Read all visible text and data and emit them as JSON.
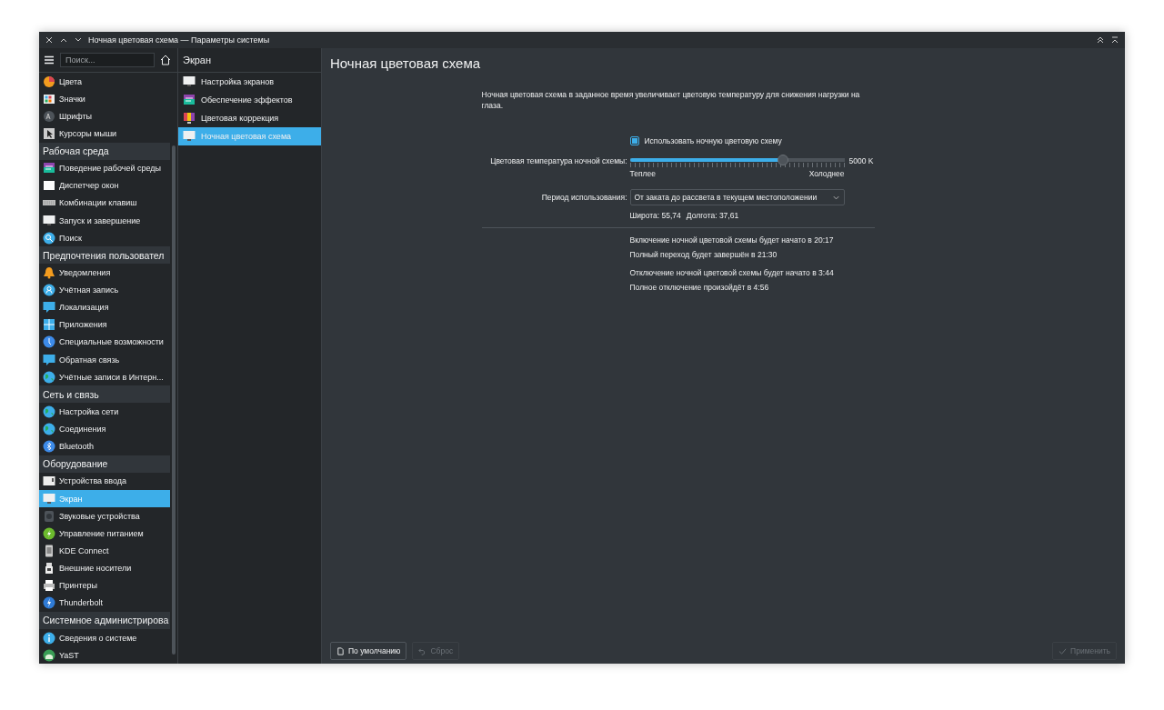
{
  "window": {
    "title": "Ночная цветовая схема — Параметры системы"
  },
  "sidebar": {
    "search": {
      "placeholder": "Поиск..."
    },
    "items": [
      {
        "kind": "item",
        "label": "Цвета",
        "selected": false
      },
      {
        "kind": "item",
        "label": "Значки",
        "selected": false
      },
      {
        "kind": "item",
        "label": "Шрифты",
        "selected": false
      },
      {
        "kind": "item",
        "label": "Курсоры мыши",
        "selected": false
      },
      {
        "kind": "header",
        "label": "Рабочая среда"
      },
      {
        "kind": "item",
        "label": "Поведение рабочей среды",
        "selected": false
      },
      {
        "kind": "item",
        "label": "Диспетчер окон",
        "selected": false
      },
      {
        "kind": "item",
        "label": "Комбинации клавиш",
        "selected": false
      },
      {
        "kind": "item",
        "label": "Запуск и завершение",
        "selected": false
      },
      {
        "kind": "item",
        "label": "Поиск",
        "selected": false
      },
      {
        "kind": "header",
        "label": "Предпочтения пользовател"
      },
      {
        "kind": "item",
        "label": "Уведомления",
        "selected": false
      },
      {
        "kind": "item",
        "label": "Учётная запись",
        "selected": false
      },
      {
        "kind": "item",
        "label": "Локализация",
        "selected": false
      },
      {
        "kind": "item",
        "label": "Приложения",
        "selected": false
      },
      {
        "kind": "item",
        "label": "Специальные возможности",
        "selected": false
      },
      {
        "kind": "item",
        "label": "Обратная связь",
        "selected": false
      },
      {
        "kind": "item",
        "label": "Учётные записи в Интерн...",
        "selected": false
      },
      {
        "kind": "header",
        "label": "Сеть и связь"
      },
      {
        "kind": "item",
        "label": "Настройка сети",
        "selected": false
      },
      {
        "kind": "item",
        "label": "Соединения",
        "selected": false
      },
      {
        "kind": "item",
        "label": "Bluetooth",
        "selected": false
      },
      {
        "kind": "header",
        "label": "Оборудование"
      },
      {
        "kind": "item",
        "label": "Устройства ввода",
        "selected": false
      },
      {
        "kind": "item",
        "label": "Экран",
        "selected": true
      },
      {
        "kind": "item",
        "label": "Звуковые устройства",
        "selected": false
      },
      {
        "kind": "item",
        "label": "Управление питанием",
        "selected": false
      },
      {
        "kind": "item",
        "label": "KDE Connect",
        "selected": false
      },
      {
        "kind": "item",
        "label": "Внешние носители",
        "selected": false
      },
      {
        "kind": "item",
        "label": "Принтеры",
        "selected": false
      },
      {
        "kind": "item",
        "label": "Thunderbolt",
        "selected": false
      },
      {
        "kind": "header",
        "label": "Системное администрирова"
      },
      {
        "kind": "item",
        "label": "Сведения о системе",
        "selected": false
      },
      {
        "kind": "item",
        "label": "YaST",
        "selected": false
      }
    ]
  },
  "subpanel": {
    "title": "Экран",
    "items": [
      {
        "label": "Настройка экранов",
        "selected": false
      },
      {
        "label": "Обеспечение эффектов",
        "selected": false
      },
      {
        "label": "Цветовая коррекция",
        "selected": false
      },
      {
        "label": "Ночная цветовая схема",
        "selected": true
      }
    ]
  },
  "page": {
    "title": "Ночная цветовая схема",
    "description": "Ночная цветовая схема в заданное время увеличивает цветовую температуру для снижения нагрузки на глаза.",
    "enable": {
      "label": "Использовать ночную цветовую схему",
      "checked": true
    },
    "temperature": {
      "label": "Цветовая температура ночной схемы:",
      "level": 0.715,
      "reading": "5000 K",
      "min_label": "Теплее",
      "max_label": "Холоднее"
    },
    "period": {
      "label": "Период использования:",
      "value": "От заката до рассвета в текущем местоположении"
    },
    "latitude": "Широта: 55,74",
    "longitude": "Долгота: 37,61",
    "schedule": [
      [
        "Включение ночной цветовой схемы будет начато в 20:17",
        "Полный переход будет завершён в 21:30"
      ],
      [
        "Отключение ночной цветовой схемы будет начато в 3:44",
        "Полное отключение произойдёт в 4:56"
      ]
    ]
  },
  "buttons": {
    "defaults": {
      "label": "По умолчанию",
      "disabled": false
    },
    "reset": {
      "label": "Сброс",
      "disabled": true
    },
    "apply": {
      "label": "Применить",
      "disabled": true
    }
  }
}
